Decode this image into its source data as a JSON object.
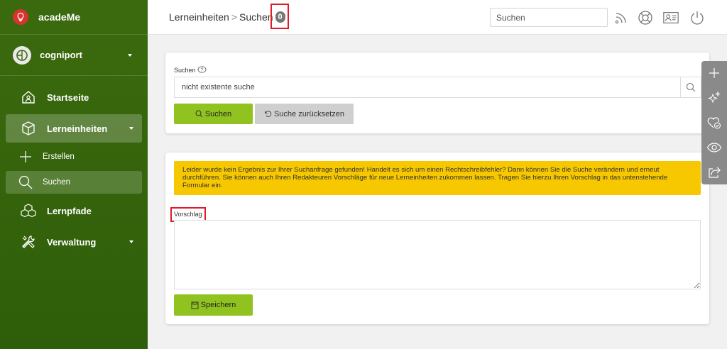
{
  "app": {
    "name": "acadeMe"
  },
  "org": {
    "name": "cogniport"
  },
  "nav": {
    "items": [
      {
        "label": "Startseite"
      },
      {
        "label": "Lerneinheiten"
      },
      {
        "label": "Erstellen"
      },
      {
        "label": "Suchen"
      },
      {
        "label": "Lernpfade"
      },
      {
        "label": "Verwaltung"
      }
    ]
  },
  "header": {
    "breadcrumb": [
      "Lerneinheiten",
      "Suchen"
    ],
    "separator": ">",
    "count_badge": "0",
    "search_placeholder": "Suchen"
  },
  "search_card": {
    "label": "Suchen",
    "value": "nicht existente suche",
    "search_button": "Suchen",
    "reset_button": "Suche zurücksetzen"
  },
  "result_card": {
    "alert": "Leider wurde kein Ergebnis zur Ihrer Suchanfrage gefunden! Handelt es sich um einen Rechtschreibfehler? Dann können Sie die Suche verändern und erneut durchführen. Sie können auch Ihren Redakteuren Vorschläge für neue Lerneinheiten zukommen lassen. Tragen Sie hierzu Ihren Vorschlag in das untenstehende Formular ein.",
    "suggestion_label": "Vorschlag",
    "suggestion_value": "",
    "save_button": "Speichern"
  },
  "icons": {
    "top": [
      "rss-icon",
      "lifebuoy-icon",
      "id-card-icon",
      "power-icon"
    ],
    "right_toolbar": [
      "plus-icon",
      "sparkle-icon",
      "heart-check-icon",
      "eye-icon",
      "share-icon"
    ]
  },
  "colors": {
    "sidebar": "#3b6a0e",
    "accent": "#90c31f",
    "alert": "#f7c800",
    "highlight": "#e01a2a"
  }
}
